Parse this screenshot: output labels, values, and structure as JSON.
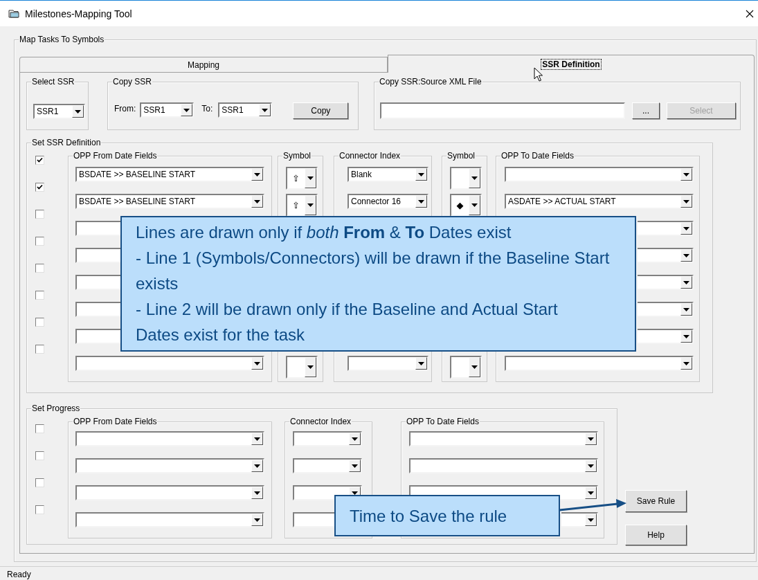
{
  "window": {
    "title": "Milestones-Mapping Tool"
  },
  "main_group": {
    "label": "Map Tasks To Symbols"
  },
  "tabs": [
    {
      "label": "Mapping",
      "selected": false
    },
    {
      "label": "SSR Definition",
      "selected": true
    }
  ],
  "select_ssr": {
    "label": "Select SSR",
    "value": "SSR1"
  },
  "copy_ssr": {
    "label": "Copy SSR",
    "from_label": "From:",
    "from_value": "SSR1",
    "to_label": "To:",
    "to_value": "SSR1",
    "button": "Copy"
  },
  "copy_source": {
    "label": "Copy SSR:Source XML File",
    "browse_button": "...",
    "select_button": {
      "label": "Select",
      "disabled": true
    }
  },
  "ssr_definition": {
    "label": "Set SSR Definition",
    "columns": [
      "OPP From Date Fields",
      "Symbol",
      "Connector Index",
      "Symbol",
      "OPP To Date Fields"
    ],
    "rows": [
      {
        "checked": true,
        "from": "BSDATE >> BASELINE START",
        "symbol_from": "⇧",
        "connector": "Blank"
      },
      {
        "checked": true,
        "from": "BSDATE >> BASELINE START",
        "symbol_from": "⇧",
        "connector": "Connector 16",
        "symbol_to": "◆",
        "to": "ASDATE >> ACTUAL START"
      },
      {
        "checked": false
      },
      {
        "checked": false
      },
      {
        "checked": false
      },
      {
        "checked": false
      },
      {
        "checked": false
      },
      {
        "checked": false
      }
    ]
  },
  "set_progress": {
    "label": "Set Progress",
    "columns": [
      "OPP From Date Fields",
      "Connector Index",
      "OPP To Date Fields"
    ],
    "rows": [
      {
        "checked": false
      },
      {
        "checked": false
      },
      {
        "checked": false
      },
      {
        "checked": false
      }
    ]
  },
  "buttons": [
    "Save Rule",
    "Help"
  ],
  "note_callout": {
    "lines": [
      "Lines are drawn only if *both* **From** & **To** Dates exist",
      "- Line 1 (Symbols/Connectors) will be drawn if the Baseline Start exists",
      "- Line 2 will be drawn only if the Baseline and Actual Start",
      "Dates exist for the task"
    ]
  },
  "save_callout": {
    "text": "Time to Save the rule"
  },
  "status_bar": {
    "text": "Ready"
  }
}
